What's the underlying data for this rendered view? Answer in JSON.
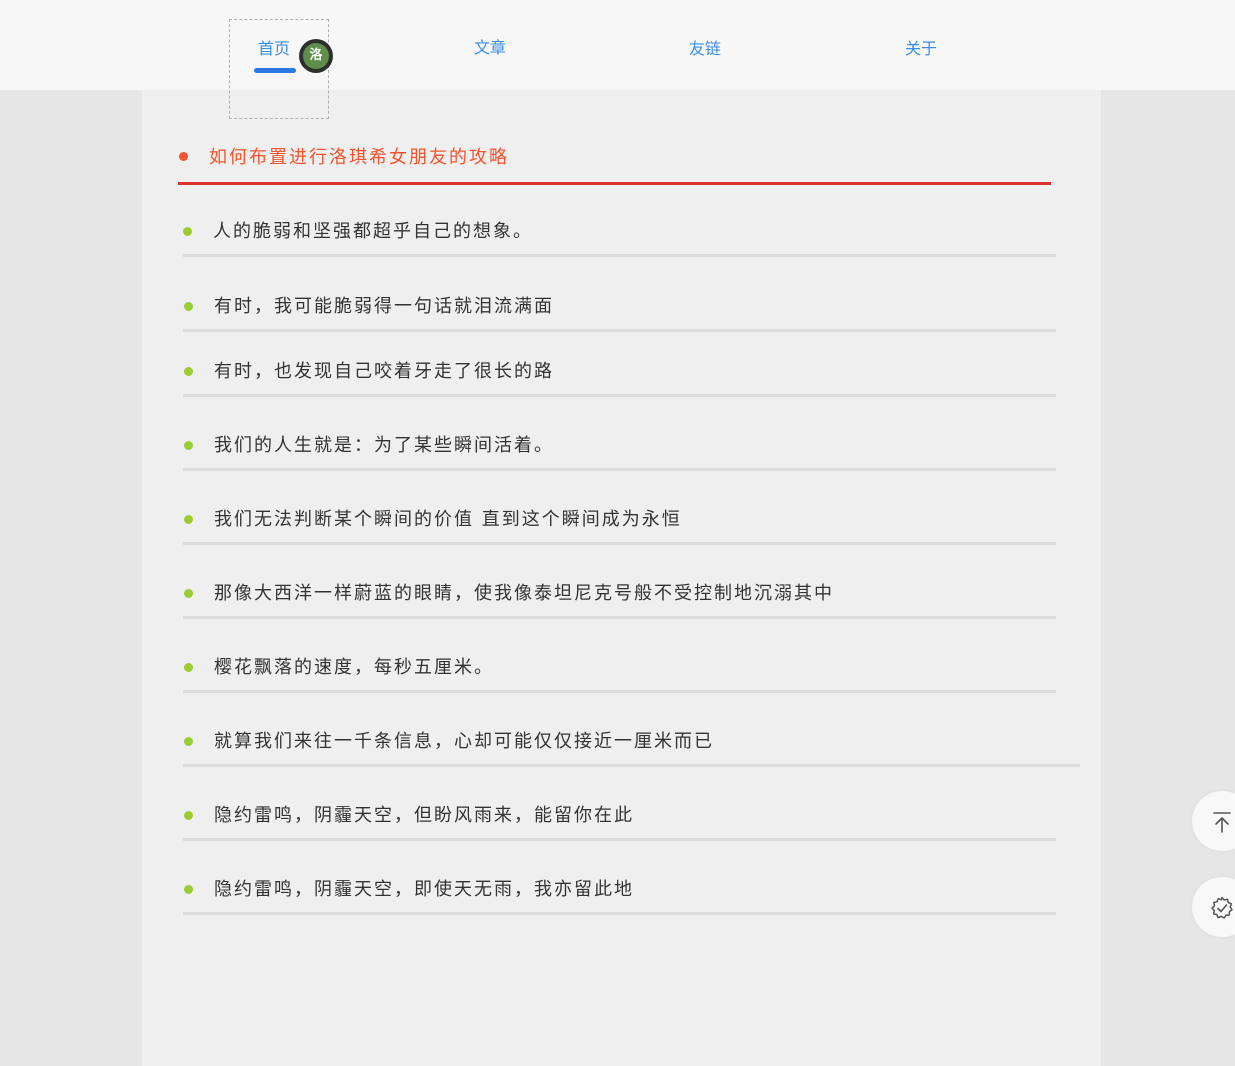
{
  "nav": {
    "items": [
      {
        "label": "首页",
        "active": true
      },
      {
        "label": "文章",
        "active": false
      },
      {
        "label": "友链",
        "active": false
      },
      {
        "label": "关于",
        "active": false
      }
    ],
    "avatar_text": "洛",
    "active_color": "#2a78e4",
    "link_color": "#3a8ee6"
  },
  "post": {
    "title": "如何布置进行洛琪希女朋友的攻略",
    "title_color": "#f2542d",
    "rule_color": "#d9322a"
  },
  "lines": [
    "人的脆弱和坚强都超乎自己的想象。",
    "有时，我可能脆弱得一句话就泪流满面",
    "有时，也发现自己咬着牙走了很长的路",
    "我们的人生就是：为了某些瞬间活着。",
    "我们无法判断某个瞬间的价值 直到这个瞬间成为永恒",
    "那像大西洋一样蔚蓝的眼睛，使我像泰坦尼克号般不受控制地沉溺其中",
    "樱花飘落的速度，每秒五厘米。",
    "就算我们来往一千条信息，心却可能仅仅接近一厘米而已",
    "隐约雷鸣，阴霾天空，但盼风雨来，能留你在此",
    "隐约雷鸣，阴霾天空，即使天无雨，我亦留此地"
  ],
  "bullet_color": "#9acd32",
  "floating": {
    "back_to_top_icon": "arrow-up-to-line-icon",
    "settings_icon": "settings-gear-icon"
  }
}
